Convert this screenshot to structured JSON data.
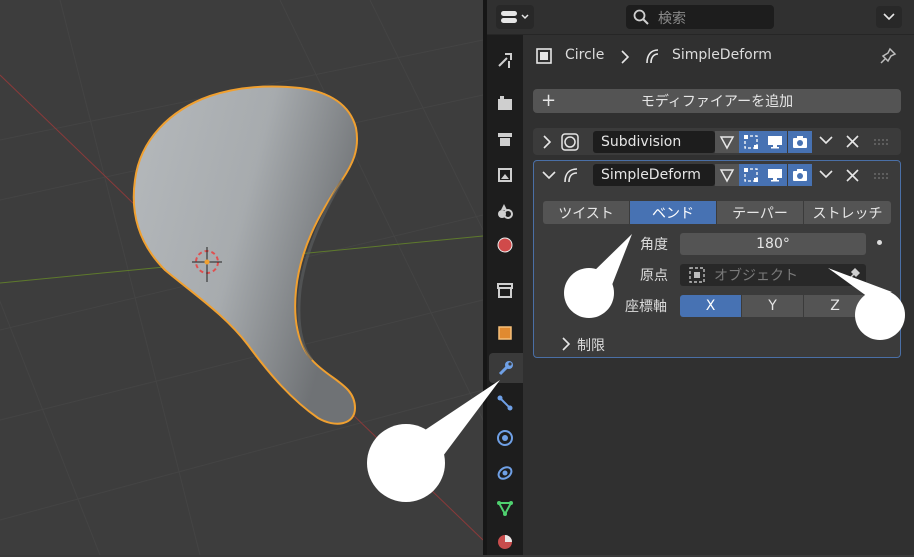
{
  "header": {
    "search_placeholder": "検索"
  },
  "breadcrumb": {
    "object_name": "Circle",
    "modifier_name": "SimpleDeform"
  },
  "add_modifier_label": "モディファイアーを追加",
  "modifiers": [
    {
      "name": "Subdivision",
      "expanded": false
    },
    {
      "name": "SimpleDeform",
      "expanded": true
    }
  ],
  "simple_deform": {
    "modes": [
      "ツイスト",
      "ベンド",
      "テーパー",
      "ストレッチ"
    ],
    "selected_mode": "ベンド",
    "angle_label": "角度",
    "angle_value": "180°",
    "origin_label": "原点",
    "origin_placeholder": "オブジェクト",
    "axis_label": "座標軸",
    "axes": [
      "X",
      "Y",
      "Z"
    ],
    "selected_axis": "X",
    "restrictions_label": "制限"
  },
  "colors": {
    "accent": "#4772b3",
    "selection_outline": "#f0a030",
    "panel_bg": "#303030",
    "viewport_bg": "#3d3d3d"
  }
}
